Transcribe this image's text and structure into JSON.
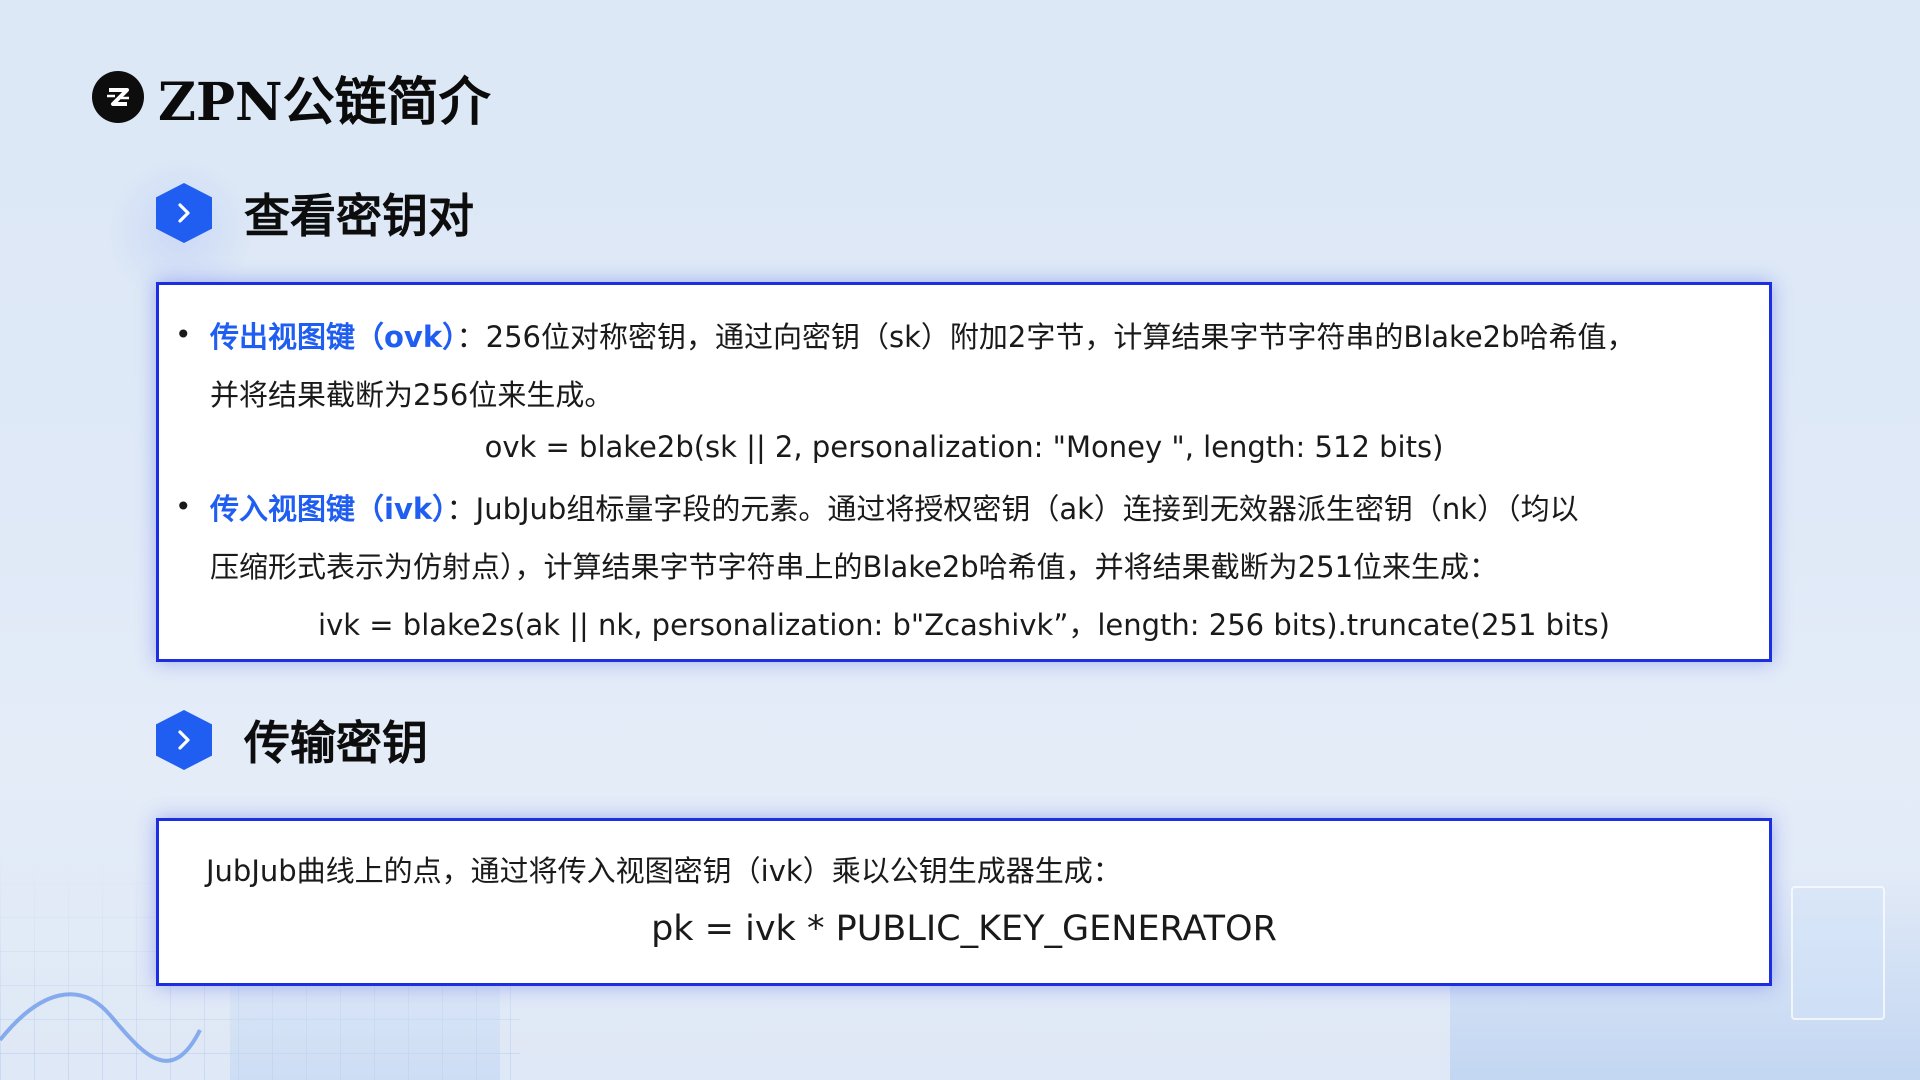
{
  "header": {
    "title": "ZPN公链简介"
  },
  "sections": [
    {
      "title": "查看密钥对",
      "items": [
        {
          "term": "传出视图键（ovk）",
          "desc_line1": "：256位对称密钥，通过向密钥（sk）附加2字节，计算结果字节字符串的Blake2b哈希值，",
          "desc_line2": "并将结果截断为256位来生成。",
          "formula": "ovk = blake2b(sk || 2, personalization: \"Money \", length: 512 bits)"
        },
        {
          "term": "传入视图键（ivk）",
          "desc_line1": "：JubJub组标量字段的元素。通过将授权密钥（ak）连接到无效器派生密钥（nk）（均以",
          "desc_line2": "压缩形式表示为仿射点），计算结果字节字符串上的Blake2b哈希值，并将结果截断为251位来生成：",
          "formula": "ivk = blake2s(ak || nk, personalization: b\"Zcashivk”，length: 256 bits).truncate(251 bits)"
        }
      ]
    },
    {
      "title": "传输密钥",
      "text": "JubJub曲线上的点，通过将传入视图密钥（ivk）乘以公钥生成器生成：",
      "formula": "pk = ivk * PUBLIC_KEY_GENERATOR"
    }
  ],
  "bullet_char": "•",
  "colors": {
    "accent": "#1f5ef0",
    "box_border": "#1b2fe0",
    "background": "#dce8f6"
  }
}
